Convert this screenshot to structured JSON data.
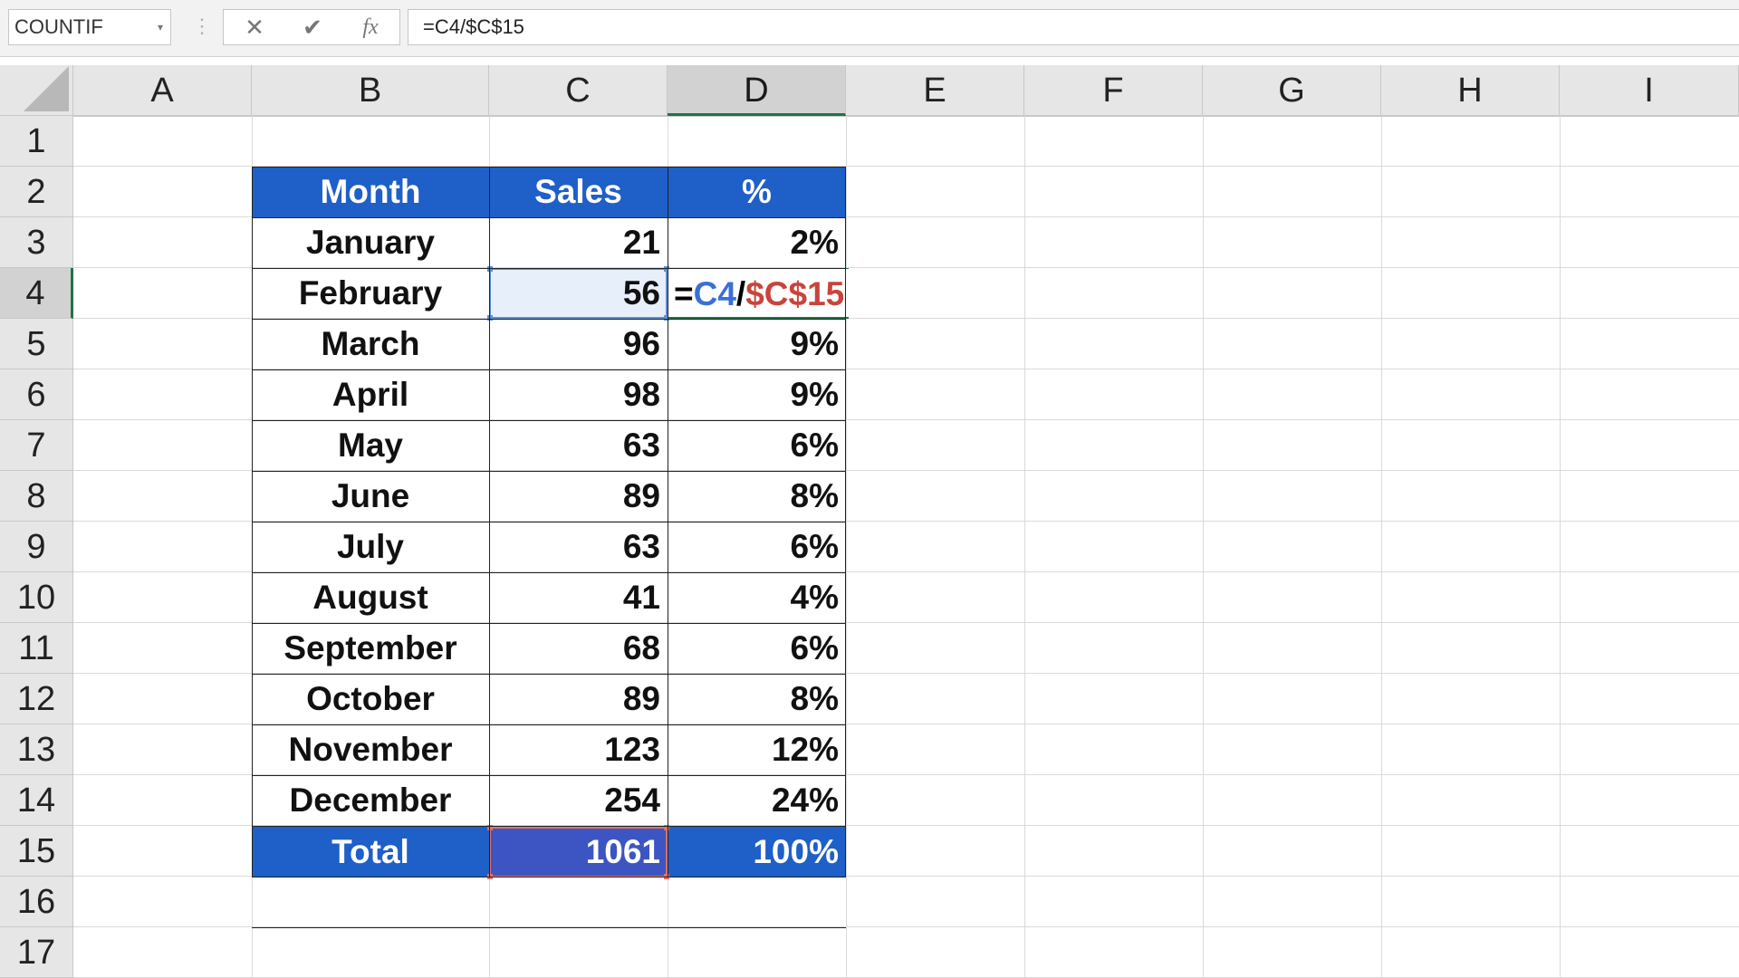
{
  "formula_bar": {
    "name_box": "COUNTIF",
    "cancel_icon": "✕",
    "enter_icon": "✔",
    "fx_icon": "fx",
    "formula": "=C4/$C$15"
  },
  "columns": [
    "A",
    "B",
    "C",
    "D",
    "E",
    "F",
    "G",
    "H",
    "I"
  ],
  "selected_column": "D",
  "rows": [
    "1",
    "2",
    "3",
    "4",
    "5",
    "6",
    "7",
    "8",
    "9",
    "10",
    "11",
    "12",
    "13",
    "14",
    "15",
    "16",
    "17"
  ],
  "selected_row": "4",
  "table": {
    "header": {
      "month": "Month",
      "sales": "Sales",
      "pct": "%"
    },
    "body": [
      {
        "month": "January",
        "sales": "21",
        "pct": "2%"
      },
      {
        "month": "February",
        "sales": "56",
        "pct": ""
      },
      {
        "month": "March",
        "sales": "96",
        "pct": "9%"
      },
      {
        "month": "April",
        "sales": "98",
        "pct": "9%"
      },
      {
        "month": "May",
        "sales": "63",
        "pct": "6%"
      },
      {
        "month": "June",
        "sales": "89",
        "pct": "8%"
      },
      {
        "month": "July",
        "sales": "63",
        "pct": "6%"
      },
      {
        "month": "August",
        "sales": "41",
        "pct": "4%"
      },
      {
        "month": "September",
        "sales": "68",
        "pct": "6%"
      },
      {
        "month": "October",
        "sales": "89",
        "pct": "8%"
      },
      {
        "month": "November",
        "sales": "123",
        "pct": "12%"
      },
      {
        "month": "December",
        "sales": "254",
        "pct": "24%"
      }
    ],
    "total": {
      "month": "Total",
      "sales": "1061",
      "pct": "100%"
    }
  },
  "edit_cell": {
    "eq": "=",
    "ref1": "C4",
    "op": "/",
    "ref2": "$C$15"
  },
  "colors": {
    "header_fill": "#1f5fc8",
    "ref_blue": "#3b6fd6",
    "ref_red": "#c8443c",
    "selection_green": "#217346"
  }
}
